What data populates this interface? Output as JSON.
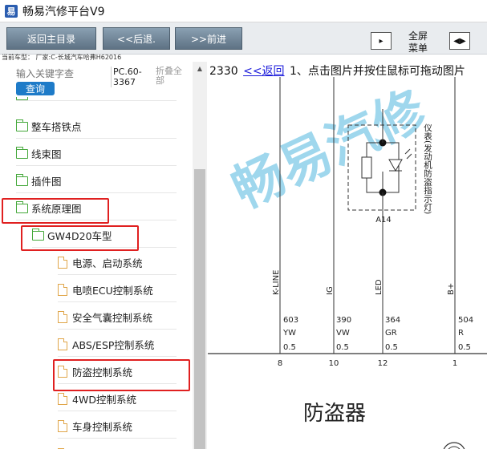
{
  "window": {
    "title": "畅易汽修平台V9",
    "icon_glyph": "易"
  },
  "toolbar": {
    "home_label": "返回主目录",
    "back_label": "<<后退.",
    "forward_label": ">>前进",
    "fullscreen_label_line1": "全屏",
    "fullscreen_label_line2": "菜单"
  },
  "vehicle": {
    "label": "当前车型：  厂家:C-长城汽车哈弗H62016"
  },
  "search": {
    "placeholder": "输入关键字查",
    "button_label": "查询",
    "code": "PC.60-3367",
    "collapse_label": "折叠全部"
  },
  "tree": {
    "items": [
      {
        "label": "整车搭铁点",
        "type": "folder"
      },
      {
        "label": "线束图",
        "type": "folder"
      },
      {
        "label": "插件图",
        "type": "folder"
      },
      {
        "label": "系统原理图",
        "type": "folder"
      },
      {
        "label": "GW4D20车型",
        "type": "folder"
      },
      {
        "label": "电源、启动系统",
        "type": "doc"
      },
      {
        "label": "电喷ECU控制系统",
        "type": "doc"
      },
      {
        "label": "安全气囊控制系统",
        "type": "doc"
      },
      {
        "label": "ABS/ESP控制系统",
        "type": "doc"
      },
      {
        "label": "防盗控制系统",
        "type": "doc"
      },
      {
        "label": "4WD控制系统",
        "type": "doc"
      },
      {
        "label": "车身控制系统",
        "type": "doc"
      }
    ],
    "highlight_color": "#e02020"
  },
  "viewer": {
    "id_text": "2330",
    "back_link": "<<返回",
    "instruction": "1、点击图片并按住鼠标可拖动图片"
  },
  "diagram": {
    "component_label": "仪表(发动机防盗指示灯)",
    "component_code": "A14",
    "signals": [
      {
        "name": "K-LINE",
        "circuit": "603",
        "color": "YW",
        "size": "0.5",
        "pin": "8"
      },
      {
        "name": "IG",
        "circuit": "390",
        "color": "VW",
        "size": "0.5",
        "pin": "10"
      },
      {
        "name": "LED",
        "circuit": "364",
        "color": "GR",
        "size": "0.5",
        "pin": "12"
      },
      {
        "name": "B+",
        "circuit": "504",
        "color": "R",
        "size": "0.5",
        "pin": "1"
      }
    ],
    "module_title": "防盗器",
    "watermark": "畅易汽修",
    "watermark_color": "#2aa6d8"
  }
}
